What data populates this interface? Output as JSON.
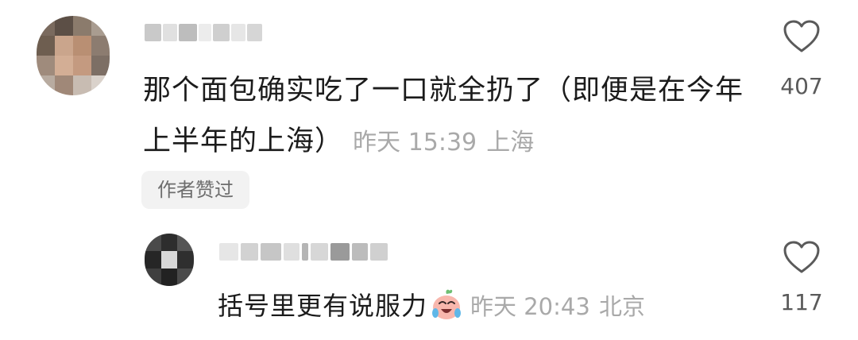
{
  "comment": {
    "username": "",
    "text": "那个面包确实吃了一口就全扔了（即便是在今年上半年的上海）",
    "time": "昨天 15:39",
    "location": "上海",
    "author_liked_badge": "作者赞过",
    "like_count": "407",
    "like_icon": "heart-outline-icon"
  },
  "reply": {
    "username": "",
    "text": "括号里更有说服力",
    "emoji": "crying-laughing-emoji",
    "time": "昨天 20:43",
    "location": "北京",
    "like_count": "117",
    "like_icon": "heart-outline-icon"
  },
  "colors": {
    "text_primary": "#1b1b1b",
    "text_meta": "#a9a9a9",
    "badge_bg": "#f2f2f2",
    "badge_text": "#6d6d6d",
    "icon": "#5a5a5a"
  }
}
